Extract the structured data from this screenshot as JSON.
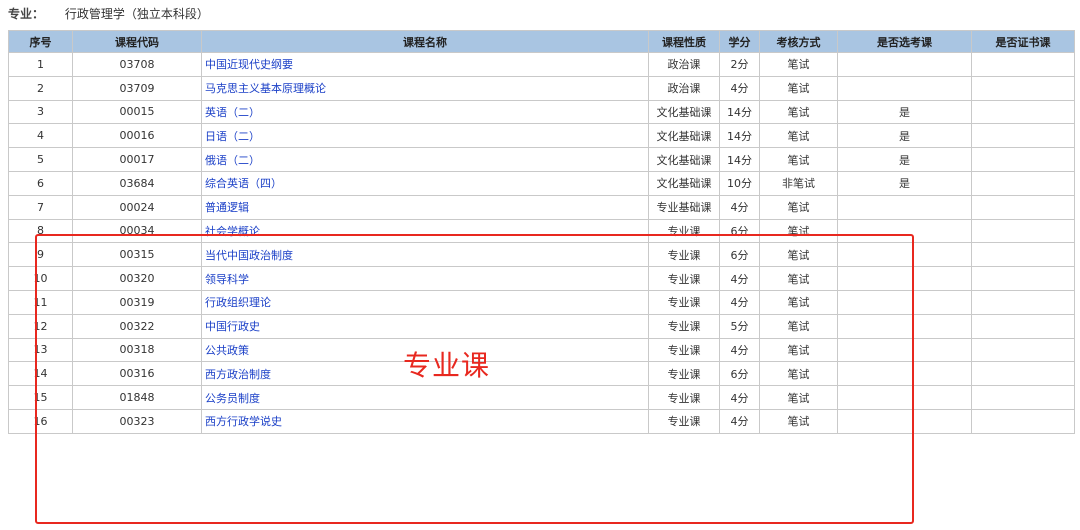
{
  "major": {
    "label": "专业：",
    "value": "行政管理学（独立本科段）"
  },
  "headers": [
    "序号",
    "课程代码",
    "课程名称",
    "课程性质",
    "学分",
    "考核方式",
    "是否选考课",
    "是否证书课"
  ],
  "rows": [
    [
      "1",
      "03708",
      "中国近现代史纲要",
      "政治课",
      "2分",
      "笔试",
      "",
      ""
    ],
    [
      "2",
      "03709",
      "马克思主义基本原理概论",
      "政治课",
      "4分",
      "笔试",
      "",
      ""
    ],
    [
      "3",
      "00015",
      "英语（二）",
      "文化基础课",
      "14分",
      "笔试",
      "是",
      ""
    ],
    [
      "4",
      "00016",
      "日语（二）",
      "文化基础课",
      "14分",
      "笔试",
      "是",
      ""
    ],
    [
      "5",
      "00017",
      "俄语（二）",
      "文化基础课",
      "14分",
      "笔试",
      "是",
      ""
    ],
    [
      "6",
      "03684",
      "综合英语（四）",
      "文化基础课",
      "10分",
      "非笔试",
      "是",
      ""
    ],
    [
      "7",
      "00024",
      "普通逻辑",
      "专业基础课",
      "4分",
      "笔试",
      "",
      ""
    ],
    [
      "8",
      "00034",
      "社会学概论",
      "专业课",
      "6分",
      "笔试",
      "",
      ""
    ],
    [
      "9",
      "00315",
      "当代中国政治制度",
      "专业课",
      "6分",
      "笔试",
      "",
      ""
    ],
    [
      "10",
      "00320",
      "领导科学",
      "专业课",
      "4分",
      "笔试",
      "",
      ""
    ],
    [
      "11",
      "00319",
      "行政组织理论",
      "专业课",
      "4分",
      "笔试",
      "",
      ""
    ],
    [
      "12",
      "00322",
      "中国行政史",
      "专业课",
      "5分",
      "笔试",
      "",
      ""
    ],
    [
      "13",
      "00318",
      "公共政策",
      "专业课",
      "4分",
      "笔试",
      "",
      ""
    ],
    [
      "14",
      "00316",
      "西方政治制度",
      "专业课",
      "6分",
      "笔试",
      "",
      ""
    ],
    [
      "15",
      "01848",
      "公务员制度",
      "专业课",
      "4分",
      "笔试",
      "",
      ""
    ],
    [
      "16",
      "00323",
      "西方行政学说史",
      "专业课",
      "4分",
      "笔试",
      "",
      ""
    ]
  ],
  "annotation": "专业课",
  "colors": {
    "header_bg": "#a9c5e2",
    "link": "#1a3fc7",
    "annotation": "#e8281f"
  }
}
